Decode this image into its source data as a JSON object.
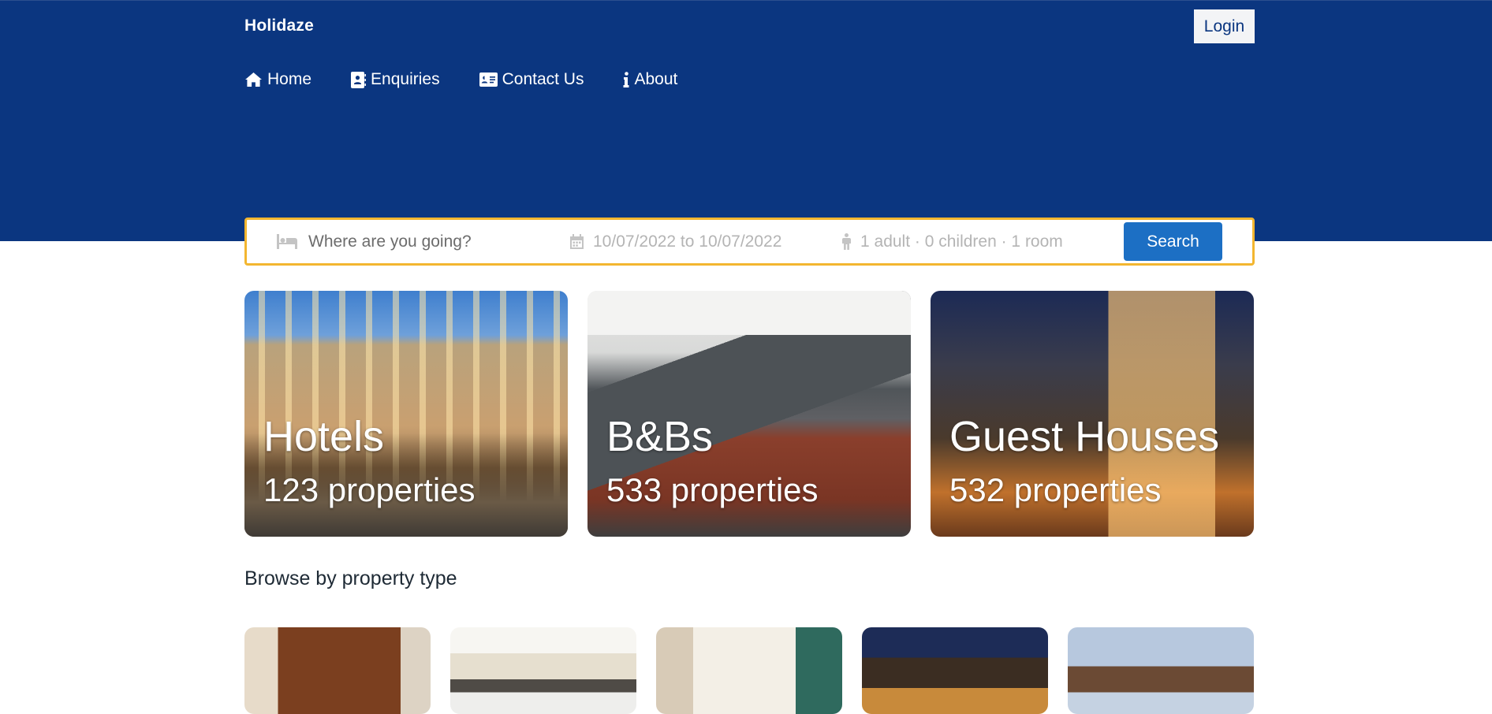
{
  "header": {
    "brand": "Holidaze",
    "login_label": "Login"
  },
  "nav": {
    "items": [
      {
        "label": "Home",
        "icon": "home-icon"
      },
      {
        "label": "Enquiries",
        "icon": "address-book-icon"
      },
      {
        "label": "Contact Us",
        "icon": "id-card-icon"
      },
      {
        "label": "About",
        "icon": "info-icon"
      }
    ]
  },
  "search": {
    "destination_placeholder": "Where are you going?",
    "dates": "10/07/2022 to 10/07/2022",
    "guests": "1 adult · 0 children · 1 room",
    "button_label": "Search",
    "border_color": "#f3b630"
  },
  "featured": [
    {
      "title": "Hotels",
      "count": "123 properties"
    },
    {
      "title": "B&Bs",
      "count": "533 properties"
    },
    {
      "title": "Guest Houses",
      "count": "532 properties"
    }
  ],
  "browse": {
    "title": "Browse by property type"
  },
  "colors": {
    "hero_bg": "#0b3680",
    "search_button": "#1c6fc4"
  }
}
